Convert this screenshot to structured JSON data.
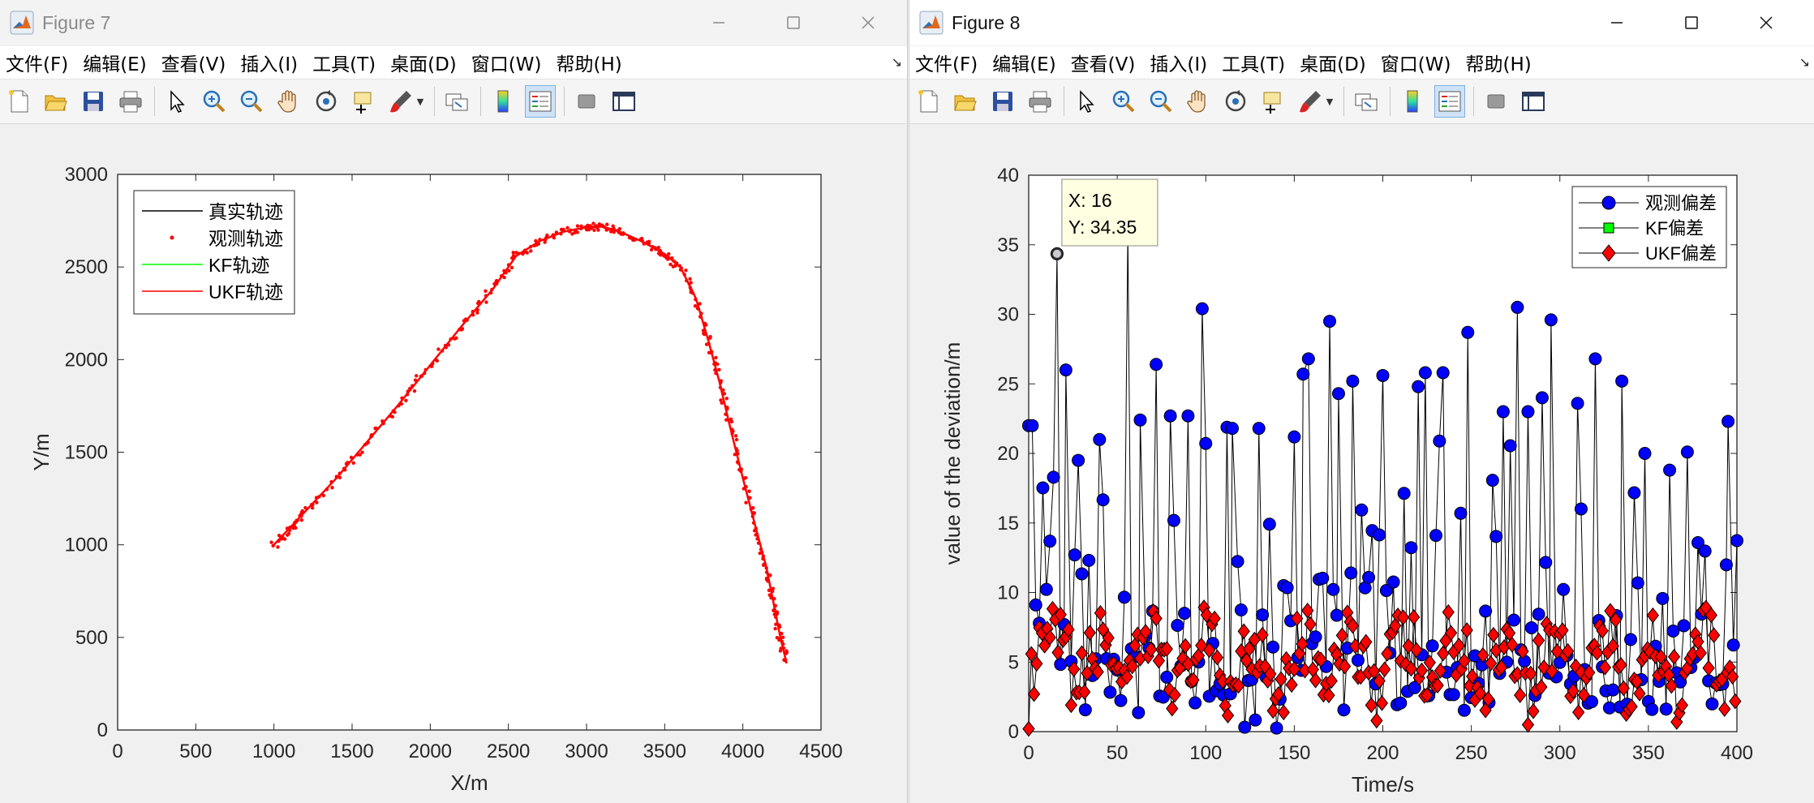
{
  "menu_labels": [
    "文件(F)",
    "编辑(E)",
    "查看(V)",
    "插入(I)",
    "工具(T)",
    "桌面(D)",
    "窗口(W)",
    "帮助(H)"
  ],
  "toolbar_icons": [
    "new-file-icon",
    "open-folder-icon",
    "save-icon",
    "print-icon",
    "pointer-icon",
    "zoom-in-icon",
    "zoom-out-icon",
    "pan-hand-icon",
    "rotate-3d-icon",
    "data-cursor-icon",
    "brush-icon",
    "link-plot-icon",
    "colorbar-icon",
    "legend-icon",
    "hide-plot-tools-icon",
    "show-plot-tools-icon"
  ],
  "figure7": {
    "title": "Figure 7",
    "title_color": "#8a8a8a",
    "chart_data": {
      "type": "line",
      "xlabel": "X/m",
      "ylabel": "Y/m",
      "xlim": [
        0,
        4500
      ],
      "ylim": [
        0,
        3000
      ],
      "xticks": [
        "0",
        "500",
        "1000",
        "1500",
        "2000",
        "2500",
        "3000",
        "3500",
        "4000",
        "4500"
      ],
      "yticks": [
        "0",
        "500",
        "1000",
        "1500",
        "2000",
        "2500",
        "3000"
      ],
      "grid": false,
      "legend_position": "top-left",
      "legend": [
        {
          "label": "真实轨迹",
          "color": "#000000",
          "style": "line"
        },
        {
          "label": "观测轨迹",
          "color": "#ff0000",
          "style": "dot"
        },
        {
          "label": "KF轨迹",
          "color": "#00ff00",
          "style": "line"
        },
        {
          "label": "UKF轨迹",
          "color": "#ff0000",
          "style": "line"
        }
      ],
      "trajectory": {
        "x": [
          1000,
          1100,
          1200,
          1400,
          1600,
          1800,
          2000,
          2200,
          2400,
          2550,
          2700,
          2850,
          3000,
          3100,
          3200,
          3350,
          3500,
          3600,
          3700,
          3780,
          3850,
          3920,
          4000,
          4080,
          4150,
          4200,
          4240,
          4280
        ],
        "y": [
          1000,
          1090,
          1180,
          1360,
          1560,
          1760,
          1970,
          2180,
          2380,
          2560,
          2640,
          2690,
          2715,
          2718,
          2695,
          2640,
          2570,
          2500,
          2330,
          2100,
          1880,
          1630,
          1360,
          1100,
          880,
          670,
          500,
          360
        ]
      }
    }
  },
  "figure8": {
    "title": "Figure 8",
    "datatip": {
      "x_label": "X: 16",
      "y_label": "Y: 34.35",
      "x": 16,
      "y": 34.35
    },
    "chart_data": {
      "type": "line",
      "xlabel": "Time/s",
      "ylabel": "value of the deviation/m",
      "xlim": [
        0,
        400
      ],
      "ylim": [
        0,
        40
      ],
      "xticks": [
        "0",
        "50",
        "100",
        "150",
        "200",
        "250",
        "300",
        "350",
        "400"
      ],
      "yticks": [
        "0",
        "5",
        "10",
        "15",
        "20",
        "25",
        "30",
        "35",
        "40"
      ],
      "grid": false,
      "legend_position": "top-right",
      "legend": [
        {
          "label": "观测偏差",
          "color": "#0000ff",
          "marker": "circle"
        },
        {
          "label": "KF偏差",
          "color": "#00ff00",
          "marker": "square"
        },
        {
          "label": "UKF偏差",
          "color": "#ff0000",
          "marker": "diamond"
        }
      ],
      "series": [
        {
          "name": "观测偏差",
          "color": "#0000ff",
          "peaks": [
            [
              2,
              22
            ],
            [
              16,
              34.35
            ],
            [
              21,
              26
            ],
            [
              28,
              19.5
            ],
            [
              40,
              21
            ],
            [
              56,
              36
            ],
            [
              63,
              22.4
            ],
            [
              72,
              26.4
            ],
            [
              80,
              22.7
            ],
            [
              90,
              22.7
            ],
            [
              98,
              30.4
            ],
            [
              115,
              21.8
            ],
            [
              130,
              21.8
            ],
            [
              155,
              25.7
            ],
            [
              158,
              26.8
            ],
            [
              170,
              29.5
            ],
            [
              175,
              24.3
            ],
            [
              183,
              25.2
            ],
            [
              200,
              25.6
            ],
            [
              220,
              24.8
            ],
            [
              224,
              25.8
            ],
            [
              234,
              25.8
            ],
            [
              248,
              28.7
            ],
            [
              268,
              23
            ],
            [
              276,
              30.5
            ],
            [
              282,
              23
            ],
            [
              290,
              24
            ],
            [
              295,
              29.6
            ],
            [
              310,
              23.6
            ],
            [
              320,
              26.8
            ],
            [
              335,
              25.2
            ],
            [
              348,
              20
            ],
            [
              362,
              18.8
            ],
            [
              372,
              20.1
            ],
            [
              395,
              22.3
            ]
          ]
        },
        {
          "name": "UKF偏差",
          "color": "#ff0000",
          "range": [
            0,
            12
          ]
        }
      ]
    }
  }
}
